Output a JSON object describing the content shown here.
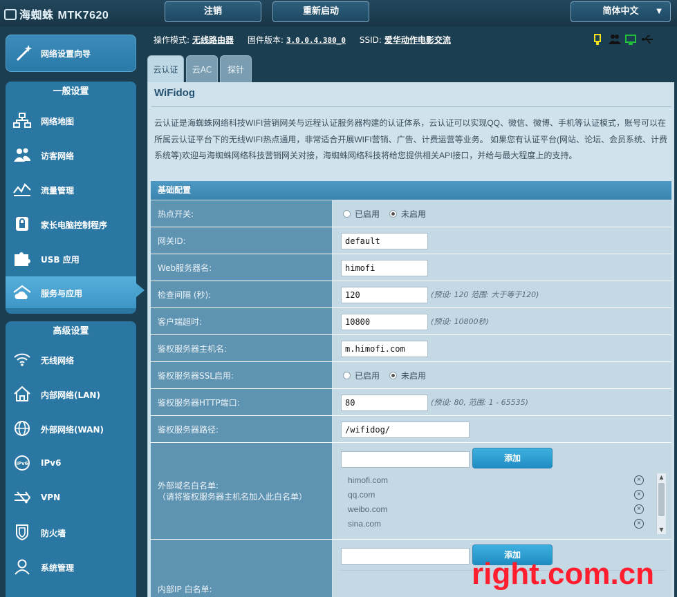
{
  "header": {
    "brand": "海蜘蛛",
    "model": "MTK7620",
    "logout_label": "注销",
    "reboot_label": "重新启动",
    "language_label": "简体中文"
  },
  "sidebar": {
    "wizard_label": "网络设置向导",
    "general_title": "一般设置",
    "general_items": [
      {
        "label": "网络地图",
        "icon": "network-map-icon"
      },
      {
        "label": "访客网络",
        "icon": "guest-network-icon"
      },
      {
        "label": "流量管理",
        "icon": "traffic-icon"
      },
      {
        "label": "家长电脑控制程序",
        "icon": "parental-lock-icon"
      },
      {
        "label": "USB 应用",
        "icon": "puzzle-icon"
      },
      {
        "label": "服务与应用",
        "icon": "cloud-service-icon",
        "active": true
      }
    ],
    "advanced_title": "高级设置",
    "advanced_items": [
      {
        "label": "无线网络",
        "icon": "wifi-icon"
      },
      {
        "label": "内部网络(LAN)",
        "icon": "home-icon"
      },
      {
        "label": "外部网络(WAN)",
        "icon": "globe-icon"
      },
      {
        "label": "IPv6",
        "icon": "ipv6-icon"
      },
      {
        "label": "VPN",
        "icon": "vpn-icon"
      },
      {
        "label": "防火墙",
        "icon": "shield-icon"
      },
      {
        "label": "系统管理",
        "icon": "user-admin-icon"
      }
    ]
  },
  "infobar": {
    "mode_label": "操作模式:",
    "mode_value": "无线路由器",
    "firmware_label": "固件版本:",
    "firmware_value": "3.0.0.4.380_0",
    "ssid_label": "SSID:",
    "ssid_value": "爱华动作电影交流"
  },
  "tabs": [
    "云认证",
    "云AC",
    "探针"
  ],
  "page": {
    "title": "WiFidog",
    "description": "云认证是海蜘蛛网络科技WIFI营销网关与远程认证服务器构建的认证体系，云认证可以实现QQ、微信、微博、手机等认证模式，账号可以在所属云认证平台下的无线WIFI热点通用，非常适合开展WIFI营销、广告、计费运营等业务。 如果您有认证平台(网站、论坛、会员系统、计费系统等)欢迎与海蜘蛛网络科技营销网关对接，海蜘蛛网络科技将给您提供相关API接口，并给与最大程度上的支持。",
    "section_title": "基础配置"
  },
  "form": {
    "hotspot": {
      "label": "热点开关:",
      "opt_on": "已启用",
      "opt_off": "未启用",
      "selected": "off"
    },
    "gateway_id": {
      "label": "网关ID:",
      "value": "default"
    },
    "web_server_name": {
      "label": "Web服务器名:",
      "value": "himofi"
    },
    "check_interval": {
      "label": "检查间隔 (秒):",
      "value": "120",
      "hint": "(预设: 120 范围: 大于等于120)"
    },
    "client_timeout": {
      "label": "客户端超时:",
      "value": "10800",
      "hint": "(预设: 10800秒)"
    },
    "auth_host": {
      "label": "鉴权服务器主机名:",
      "value": "m.himofi.com"
    },
    "auth_ssl": {
      "label": "鉴权服务器SSL启用:",
      "opt_on": "已启用",
      "opt_off": "未启用",
      "selected": "off"
    },
    "auth_port": {
      "label": "鉴权服务器HTTP端口:",
      "value": "80",
      "hint": "(预设: 80, 范围: 1 - 65535)"
    },
    "auth_path": {
      "label": "鉴权服务器路径:",
      "value": "/wifidog/"
    },
    "domain_whitelist": {
      "label": "外部域名白名单:",
      "sublabel": "（请将鉴权服务器主机名加入此白名单）",
      "input_value": "",
      "add_label": "添加",
      "items": [
        "himofi.com",
        "qq.com",
        "weibo.com",
        "sina.com"
      ]
    },
    "ip_whitelist": {
      "label": "内部IP 白名单:",
      "input_value": "",
      "add_label": "添加"
    }
  },
  "watermark": "right.com.cn"
}
